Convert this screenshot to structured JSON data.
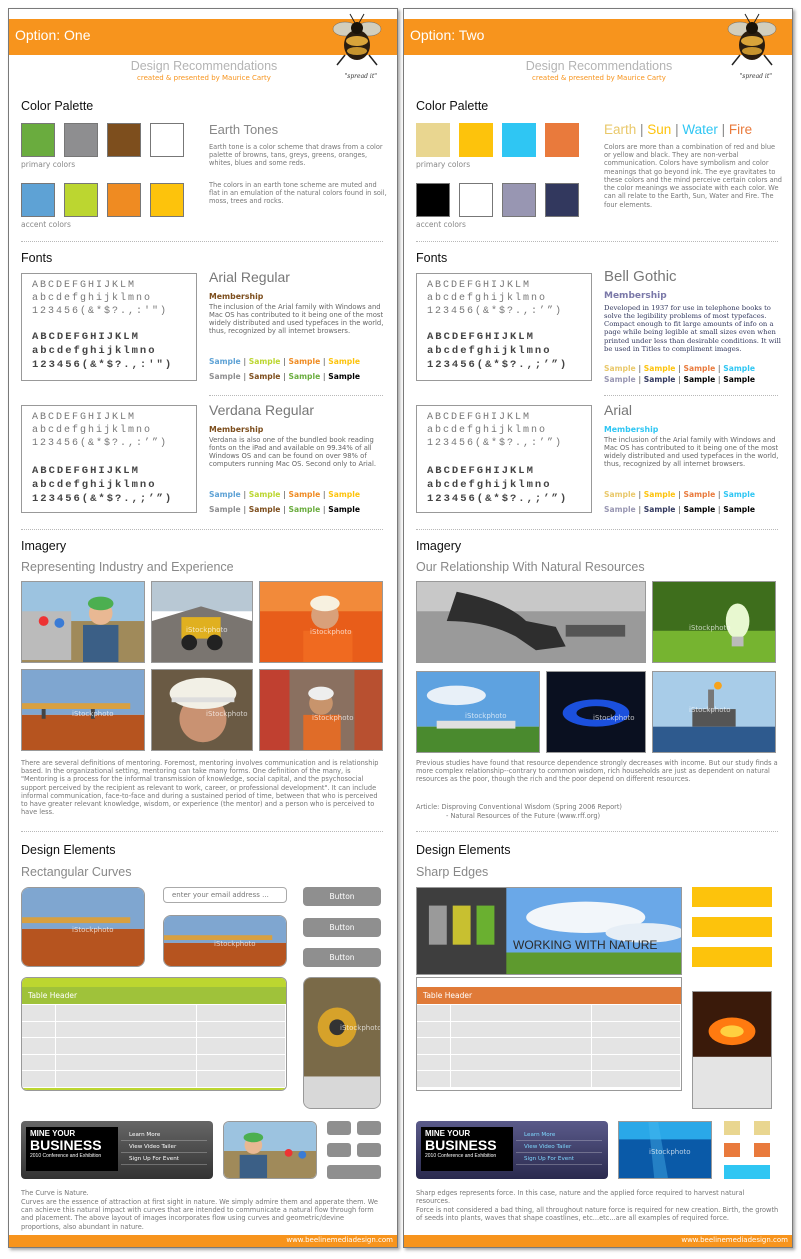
{
  "colors": {
    "orange": "#f7941d",
    "earth_green": "#6aac3e",
    "earth_gray": "#8e8e90",
    "earth_brown": "#7d4e1d",
    "accent_blue": "#5ea2d5",
    "accent_lime": "#bcd630",
    "accent_orange": "#ef8b22",
    "accent_yellow": "#fdc30c",
    "tan": "#e9d690",
    "sun": "#fdc30c",
    "water": "#2fc6f3",
    "fire": "#e97a3c",
    "lavender": "#9896b2",
    "navy": "#32385e"
  },
  "header": {
    "design_title": "Design Recommendations",
    "design_sub": "created & presented by Maurice Carty",
    "spread": "\"spread it\""
  },
  "footer": {
    "url": "www.beelinemediadesign.com"
  },
  "sections": {
    "color_palette": "Color Palette",
    "fonts": "Fonts",
    "imagery": "Imagery",
    "design_elements": "Design Elements",
    "primary_colors": "primary colors",
    "accent_colors": "accent colors"
  },
  "font_samples": {
    "upper": "ABCDEFGHIJKLM",
    "lower": "abcdefghijklmno",
    "nums_a": "123456(&*$?.,:'\")",
    "nums_b": "123456(&*$?.,:'\")",
    "nums_c": "123456(&*$?.,:’”)",
    "nums_d": "123456(&*$?.,;’”)"
  },
  "labels": {
    "membership": "Membership",
    "sample": "Sample",
    "sep": " | "
  },
  "option_one": {
    "title": "Option: One",
    "palette_name": "Earth Tones",
    "palette_text1": "Earth tone is a color scheme that draws from a color palette of browns, tans, greys, greens, oranges, whites, blues and some reds.",
    "palette_text2": "The colors in an earth tone scheme are muted and flat in an emulation of the natural colors found in soil, moss, trees and rocks.",
    "font1_name": "Arial Regular",
    "font1_desc": "The inclusion of the Arial family with Windows and Mac OS has contributed to it being one of the most widely distributed and used typefaces in the world, thus, recognized by all internet browsers.",
    "font2_name": "Verdana Regular",
    "font2_desc": "Verdana is also one of the bundled book reading fonts on the iPad and available on 99.34% of all Windows OS and can be found on over 98% of computers running Mac OS. Second only to Arial.",
    "imagery_sub": "Representing Industry and Experience",
    "imagery_text": "There are several definitions of mentoring. Foremost, mentoring involves communication and is relationship based. In the organizational setting, mentoring can take many forms. One definition of the many, is \"Mentoring is a process for the informal transmission of knowledge, social capital, and the psychosocial support perceived by the recipient as relevant to work, career, or professional development\". It can include informal communication, face-to-face and during a sustained period of time, between that who is perceived to have greater relevant knowledge, wisdom, or experience (the mentor) and a person who is perceived to have less.",
    "elements_sub": "Rectangular Curves",
    "email_placeholder": "enter your email address ...",
    "button": "Button",
    "table_header": "Table Header",
    "elements_title": "The Curve is Nature.",
    "elements_text": "Curves are the essence of attraction at first sight in nature. We simply admire them and apperate them. We can achieve this natural impact with curves that are intended to communicate a natural flow through form and placement.  The above layout of images incorporates flow using curves and geometric/devine proportions, also abundant in nature."
  },
  "option_two": {
    "title": "Option: Two",
    "palette_names": [
      "Earth",
      "Sun",
      "Water",
      "Fire"
    ],
    "palette_text": "Colors are more than a combination of red and blue or yellow and black. They are non-verbal communication. Colors have symbolism and color meanings that go beyond ink. The eye gravitates to these colors and the mind perceive certain colors and the color meanings we associate with each color. We can all relate to the Earth, Sun, Water and Fire. The four elements.",
    "font1_name": "Bell Gothic",
    "font1_desc": "Developed in 1937 for use in telephone books to solve the legibility problems of most typefaces. Compact enough to fit large amounts of info on a page while being legible at small sizes even when printed under less than desirable conditions. It will be used in Titles to compliment images.",
    "font2_name": "Arial",
    "font2_desc": "The inclusion of the Arial family with Windows and Mac OS has contributed to it being one of the most widely distributed and used typefaces in the world, thus, recognized by all internet browsers.",
    "imagery_sub": "Our Relationship With Natural Resources",
    "imagery_text": "Previous studies have found that resource dependence strongly decreases with income. But our study finds a more complex relationship--contrary to common wisdom, rich households are just as dependent on natural resources as the poor, though the rich and the poor depend on different resources.",
    "article": "Article: Disproving Conventional Wisdom (Spring 2006 Report)",
    "article_src": "- Natural Resources of the Future (www.rff.org)",
    "elements_sub": "Sharp Edges",
    "working": "WORKING WITH NATURE",
    "table_header": "Table Header",
    "elements_text1": "Sharp edges represents force. In this case, nature and the applied force required to harvest natural resources.",
    "elements_text2": "Force is not considered a bad thing, all throughout nature force is required for new creation. Birth, the growth of seeds into plants, waves that shape coastlines, etc...etc...are all examples of required force."
  },
  "banner": {
    "line1": "MINE YOUR",
    "line2": "BUSINESS",
    "line3": "2010 Conference and Exhibition",
    "learn": "Learn More",
    "video": "View Video Tailer",
    "signup": "Sign Up For Event"
  },
  "watermark": "iStockphoto"
}
